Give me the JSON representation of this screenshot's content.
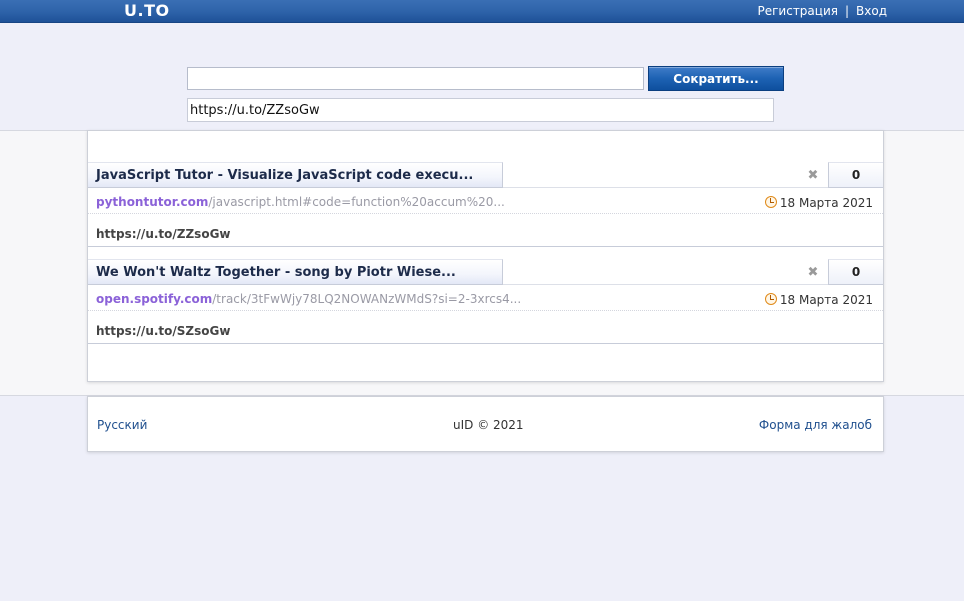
{
  "header": {
    "logo": "U.TO",
    "register_link": "Регистрация",
    "separator": "|",
    "login_link": "Вход"
  },
  "form": {
    "url_input_value": "",
    "shorten_button": "Сократить...",
    "result_value": "https://u.to/ZZsoGw"
  },
  "links": [
    {
      "title": "JavaScript Tutor - Visualize JavaScript code execu...",
      "source_domain": "pythontutor.com",
      "source_path": "/javascript.html#code=function%20accum%20...",
      "date": "18 Марта 2021",
      "clicks": "0",
      "short_url": "https://u.to/ZZsoGw",
      "delete_icon": "close-x-icon"
    },
    {
      "title": "We Won't Waltz Together - song by Piotr Wiese...",
      "source_domain": "open.spotify.com",
      "source_path": "/track/3tFwWjy78LQ2NOWANzWMdS?si=2-3xrcs4...",
      "date": "18 Марта 2021",
      "clicks": "0",
      "short_url": "https://u.to/SZsoGw",
      "delete_icon": "close-x-icon"
    }
  ],
  "footer": {
    "language": "Русский",
    "copyright": "uID © 2021",
    "complaint_form": "Форма для жалоб"
  },
  "colors": {
    "topbar": "#2d62a9",
    "accent_button": "#1d62b3",
    "source_domain": "#8b62d8",
    "link_blue": "#1f4f8e",
    "page_background": "#eeeff9"
  }
}
